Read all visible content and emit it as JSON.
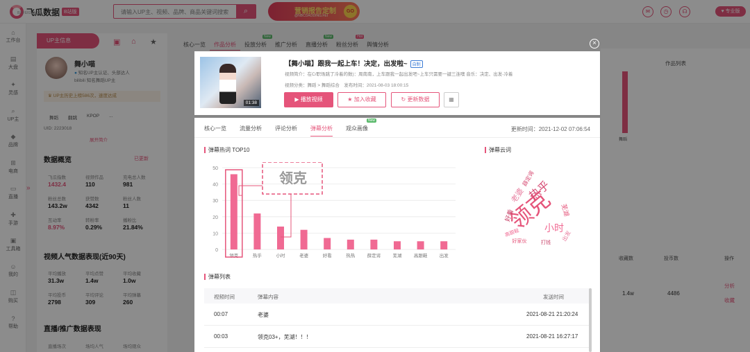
{
  "topbar": {
    "logo_name": "飞瓜数据",
    "logo_badge": "B站版",
    "logo_sub": "BZ.FEIGUA.CN",
    "search_placeholder": "请输入UP主、视频、品牌、商品关键词搜索",
    "banner_title": "营销报告定制",
    "banner_sub": "@NBCDAODING.FEI",
    "banner_go": "GO",
    "member_label": "专业版"
  },
  "sidebar": [
    {
      "label": "工作台",
      "icon": "home-icon"
    },
    {
      "label": "大盘",
      "icon": "chart-icon"
    },
    {
      "label": "灵感",
      "icon": "bulb-icon"
    },
    {
      "label": "UP主",
      "icon": "search-icon"
    },
    {
      "label": "品牌",
      "icon": "diamond-icon"
    },
    {
      "label": "电商",
      "icon": "cart-icon"
    },
    {
      "label": "直播",
      "icon": "tv-icon"
    },
    {
      "label": "手游",
      "icon": "gamepad-icon"
    },
    {
      "label": "工具箱",
      "icon": "toolbox-icon"
    },
    {
      "label": "我的",
      "icon": "user-icon"
    },
    {
      "label": "购买",
      "icon": "bag-icon"
    },
    {
      "label": "帮助",
      "icon": "help-icon"
    }
  ],
  "up": {
    "panel_title": "UP主信息",
    "name": "舞小喵",
    "cert": "知名UP主认证、头部达人",
    "bili": "bilibili 知名舞蹈UP主",
    "notice": "UP主历史上榜586次，速度达成",
    "tags": [
      "舞蹈",
      "翻跳",
      "KPOP",
      "..."
    ],
    "uid": "UID: 2223018",
    "expand": "展开简介"
  },
  "overview": {
    "title": "数据概览",
    "link": "已更新",
    "stats": [
      {
        "label": "飞瓜指数",
        "value": "1432.4",
        "pink": true
      },
      {
        "label": "视频作品",
        "value": "110"
      },
      {
        "label": "充电总人数",
        "value": "981"
      },
      {
        "label": "粉丝总数",
        "value": "143.2w"
      },
      {
        "label": "获赞数",
        "value": "4342"
      },
      {
        "label": "粉丝人数",
        "value": "11"
      },
      {
        "label": "互动率",
        "value": "8.97%",
        "pink": true
      },
      {
        "label": "转粉率",
        "value": "0.29%"
      },
      {
        "label": "播粉比",
        "value": "21.84%"
      }
    ]
  },
  "popularity": {
    "title": "视频人气数据表现(近90天)",
    "stats": [
      {
        "label": "平均播放",
        "value": "31.3w"
      },
      {
        "label": "平均点赞",
        "value": "1.4w"
      },
      {
        "label": "平均收藏",
        "value": "1.0w"
      },
      {
        "label": "平均投币",
        "value": "2798"
      },
      {
        "label": "平均评论",
        "value": "309"
      },
      {
        "label": "平均弹幕",
        "value": "260"
      }
    ]
  },
  "live": {
    "title": "直播/推广数据表现",
    "labels": [
      "直播场次",
      "场均人气",
      "场均观众"
    ]
  },
  "bg_tabs": [
    {
      "label": "核心一览"
    },
    {
      "label": "作品分析",
      "active": true
    },
    {
      "label": "投放分析",
      "badge": "New"
    },
    {
      "label": "推广分析"
    },
    {
      "label": "直播分析",
      "badge": "New"
    },
    {
      "label": "粉丝分析",
      "badge": "Hot"
    },
    {
      "label": "舆情分析"
    }
  ],
  "bg_right": {
    "works_title": "作品列表",
    "dance_label": "舞蹈",
    "th_coins": "收藏数",
    "th_favs": "投币数",
    "th_ops": "操作",
    "val_a": "1.4w",
    "val_b": "4486",
    "link_analyze": "分析",
    "link_collect": "收藏"
  },
  "video": {
    "title": "【舞小喵】跟我一起上车！决定，出发啦~",
    "badge": "自制",
    "desc": "视频简介：在C/职场跳了冷着的数)：周南南，上车跟我一起出发吧~上车只需要一键三连噢 音乐：决定、出发-冷着",
    "meta": "视频分类：舞蹈 > 舞蹈综合　发布时间：2021-08-03 18:00:15",
    "duration": "01:38",
    "btn_play": "播放视频",
    "btn_fav": "加入收藏",
    "btn_refresh": "更新数据"
  },
  "modal": {
    "tabs": [
      {
        "label": "核心一览"
      },
      {
        "label": "流量分析"
      },
      {
        "label": "评论分析"
      },
      {
        "label": "弹幕分析",
        "active": true
      },
      {
        "label": "观众画像",
        "badge": "New"
      }
    ],
    "updated": "更新时间：2021-12-02 07:06:54",
    "chart_title": "弹幕热词 TOP10",
    "cloud_title": "弹幕云词",
    "list_title": "弹幕列表",
    "list_headers": [
      "视频时间",
      "弹幕内容",
      "发送时间"
    ],
    "rows": [
      {
        "t": "00:07",
        "content": "老婆",
        "sent": "2021-08-21 21:20:24"
      },
      {
        "t": "00:03",
        "content": "领克03+，芜湖！！！",
        "sent": "2021-08-21 16:27:17"
      }
    ],
    "callout_word": "领克"
  },
  "chart_data": {
    "type": "bar",
    "title": "弹幕热词 TOP10",
    "categories": [
      "领克",
      "热乎",
      "小时",
      "老婆",
      "好看",
      "热热",
      "薛定谔",
      "芜湖",
      "高跟鞋",
      "出发"
    ],
    "values": [
      46,
      22,
      14,
      12,
      7,
      6,
      6,
      5,
      5,
      5
    ],
    "ylim": [
      0,
      50
    ],
    "yticks": [
      0,
      10,
      20,
      30,
      40,
      50
    ],
    "grid": true,
    "bar_color": "#f06a93",
    "highlight_color": "#e5547a"
  },
  "cloud_words": [
    {
      "text": "领克",
      "big": true
    },
    {
      "text": "热乎"
    },
    {
      "text": "小时"
    },
    {
      "text": "老婆"
    },
    {
      "text": "好看"
    },
    {
      "text": "芜湖"
    },
    {
      "text": "薛定谔"
    },
    {
      "text": "高跟鞋"
    },
    {
      "text": "出发"
    },
    {
      "text": "打钱"
    },
    {
      "text": "好家伙"
    }
  ]
}
